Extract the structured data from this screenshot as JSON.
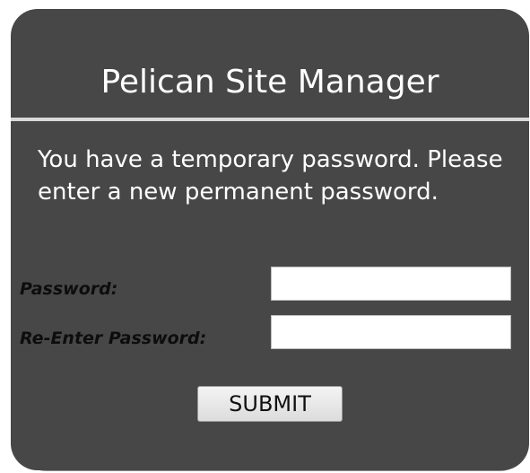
{
  "header": {
    "title": "Pelican Site Manager"
  },
  "message": "You have a temporary password. Please enter a new permanent password.",
  "form": {
    "password_label": "Password:",
    "password_value": "",
    "reenter_label": "Re-Enter Password:",
    "reenter_value": "",
    "submit_label": "SUBMIT"
  },
  "colors": {
    "panel_background": "#474747",
    "title_text": "#ffffff",
    "label_text": "#0d0d0d"
  }
}
